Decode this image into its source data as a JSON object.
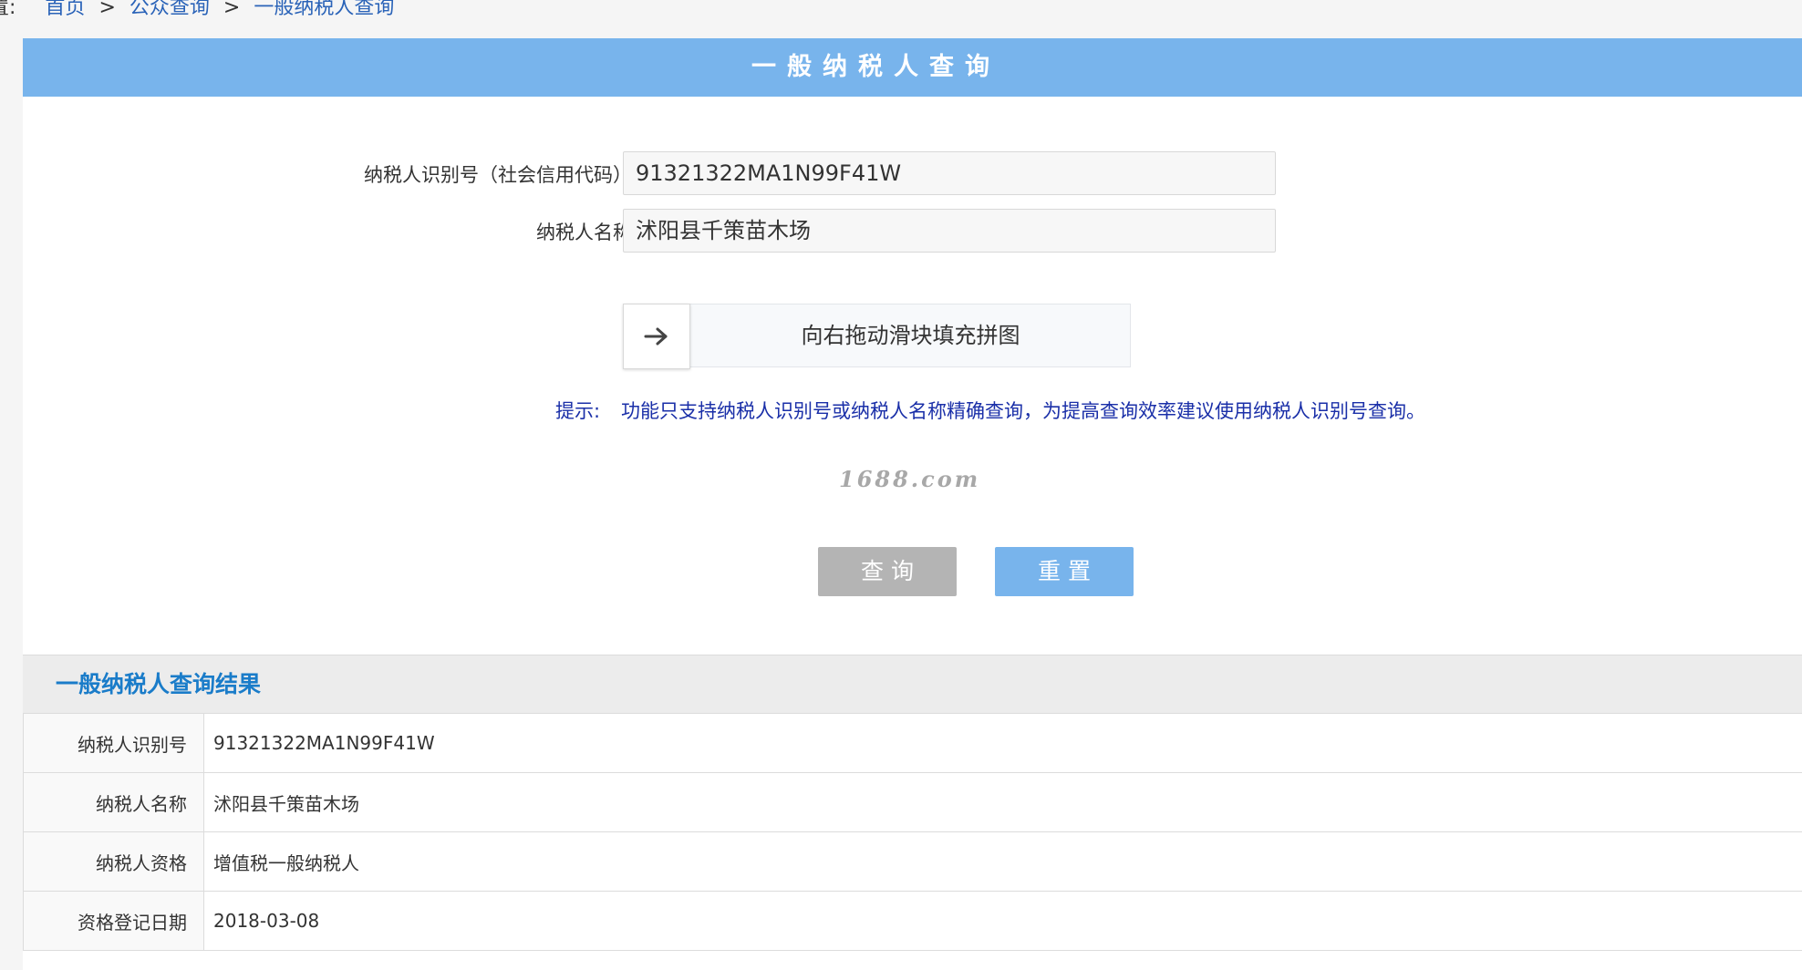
{
  "breadcrumb": {
    "prefix": "置:",
    "home": "首页",
    "sep": ">",
    "section": "公众查询",
    "current": "一般纳税人查询"
  },
  "header": {
    "title": "一般纳税人查询"
  },
  "form": {
    "taxpayer_id_label": "纳税人识别号（社会信用代码）",
    "taxpayer_id_value": "91321322MA1N99F41W",
    "taxpayer_name_label": "纳税人名称",
    "taxpayer_name_value": "沭阳县千策苗木场"
  },
  "captcha": {
    "handle_icon": "arrow-right-icon",
    "text": "向右拖动滑块填充拼图"
  },
  "tip": {
    "label": "提示:",
    "text": "功能只支持纳税人识别号或纳税人名称精确查询，为提高查询效率建议使用纳税人识别号查询。"
  },
  "watermark": "1688.com",
  "buttons": {
    "query": "查询",
    "reset": "重置"
  },
  "results": {
    "title": "一般纳税人查询结果",
    "rows": [
      {
        "key": "纳税人识别号",
        "value": "91321322MA1N99F41W"
      },
      {
        "key": "纳税人名称",
        "value": "沭阳县千策苗木场"
      },
      {
        "key": "纳税人资格",
        "value": "增值税一般纳税人"
      },
      {
        "key": "资格登记日期",
        "value": "2018-03-08"
      }
    ]
  },
  "colors": {
    "header_bg": "#78b4ec",
    "query_btn": "#b4b4b4",
    "reset_btn": "#78b4ec",
    "results_title": "#1a7cc9",
    "tip_text": "#1a2fa8"
  }
}
